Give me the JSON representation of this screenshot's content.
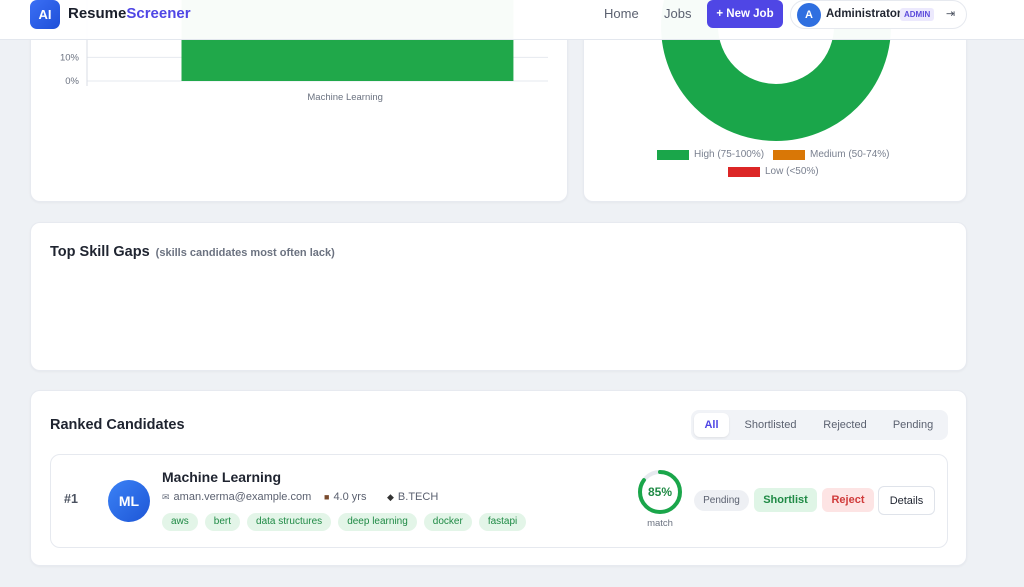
{
  "header": {
    "logo_initials": "AI",
    "brand_part1": "Resume",
    "brand_part2": "Screener",
    "nav": [
      "Home",
      "Jobs"
    ],
    "new_job_label": "+ New Job",
    "user_initial": "A",
    "user_name": "Administrator",
    "user_role": "ADMIN",
    "logout_icon": "logout-icon"
  },
  "chart_data": [
    {
      "type": "bar",
      "categories": [
        "Machine Learning"
      ],
      "values": [
        100
      ],
      "visible_ticks": [
        "0%",
        "10%"
      ],
      "ylim": [
        0,
        100
      ],
      "color": "#20a84a",
      "grid": true
    },
    {
      "type": "pie",
      "style": "donut",
      "categories": [
        "High (75-100%)",
        "Medium (50-74%)",
        "Low (<50%)"
      ],
      "values": [
        1,
        0,
        0
      ],
      "colors": [
        "#1aa64a",
        "#d97706",
        "#dc2626"
      ],
      "legend_placement": "bottom"
    }
  ],
  "skill_gaps": {
    "title": "Top Skill Gaps",
    "subtitle": "(skills candidates most often lack)"
  },
  "ranked": {
    "title": "Ranked Candidates",
    "filters": [
      "All",
      "Shortlisted",
      "Rejected",
      "Pending"
    ],
    "active_filter": "All",
    "candidates": [
      {
        "rank": "#1",
        "initials": "ML",
        "name": "Machine Learning",
        "email": "aman.verma@example.com",
        "experience": "4.0 yrs",
        "degree": "B.TECH",
        "skills": [
          "aws",
          "bert",
          "data structures",
          "deep learning",
          "docker",
          "fastapi"
        ],
        "match_percent": 85,
        "match_text": "85%",
        "match_label": "match",
        "status": "Pending",
        "actions": [
          "Shortlist",
          "Reject",
          "Details"
        ]
      }
    ]
  },
  "colors": {
    "accent": "#4f46e5",
    "success": "#1aa64a",
    "danger": "#dc2626",
    "warning": "#d97706"
  }
}
